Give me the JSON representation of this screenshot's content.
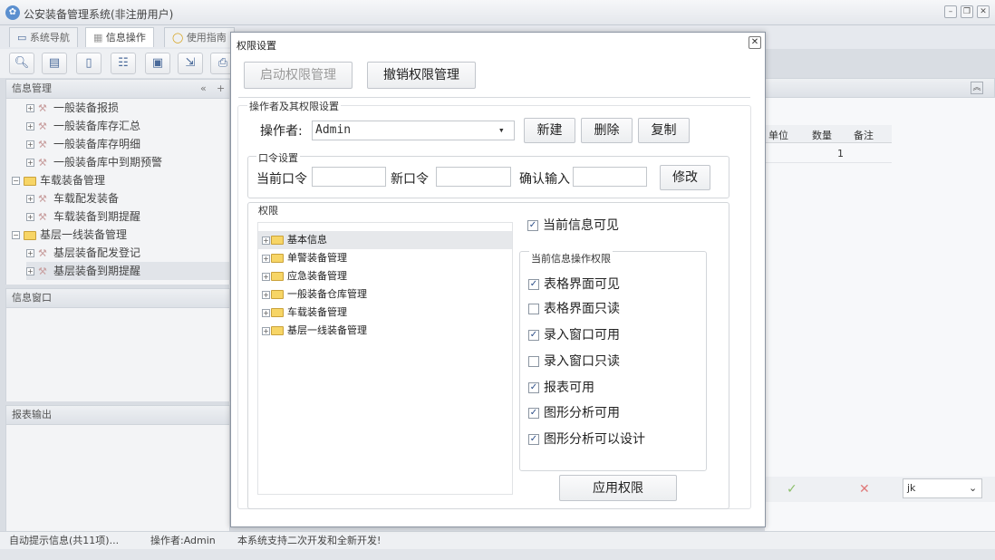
{
  "window": {
    "title": "公安装备管理系统(非注册用户)",
    "tabs": [
      "系统导航",
      "信息操作",
      "使用指南"
    ]
  },
  "left_panel": {
    "info_mgmt_title": "信息管理",
    "tree": [
      {
        "label": "一般装备报损",
        "kind": "leaf"
      },
      {
        "label": "一般装备库存汇总",
        "kind": "leaf"
      },
      {
        "label": "一般装备库存明细",
        "kind": "leaf"
      },
      {
        "label": "一般装备库中到期预警",
        "kind": "leaf"
      },
      {
        "label": "车载装备管理",
        "kind": "folder"
      },
      {
        "label": "车载配发装备",
        "kind": "leaf"
      },
      {
        "label": "车载装备到期提醒",
        "kind": "leaf"
      },
      {
        "label": "基层一线装备管理",
        "kind": "folder"
      },
      {
        "label": "基层装备配发登记",
        "kind": "leaf"
      },
      {
        "label": "基层装备到期提醒",
        "kind": "leaf"
      }
    ],
    "info_window_title": "信息窗口",
    "report_output_title": "报表输出"
  },
  "right_grid": {
    "columns": [
      "单位",
      "数量",
      "备注"
    ],
    "rows": [
      [
        "",
        "1",
        ""
      ]
    ],
    "ok_symbol": "✓",
    "cancel_symbol": "✕",
    "selector_value": "jk"
  },
  "statusbar": {
    "hint": "自动提示信息(共11项)...",
    "operator": "操作者:Admin",
    "message": "本系统支持二次开发和全新开发!"
  },
  "dialog": {
    "title": "权限设置",
    "close_symbol": "✕",
    "enable_button": "启动权限管理",
    "revoke_button": "撤销权限管理",
    "operator_section": "操作者及其权限设置",
    "operator_label": "操作者:",
    "operator_value": "Admin",
    "new_button": "新建",
    "delete_button": "删除",
    "copy_button": "复制",
    "password_section": "口令设置",
    "current_pwd_label": "当前口令",
    "new_pwd_label": "新口令",
    "confirm_pwd_label": "确认输入",
    "modify_button": "修改",
    "permission_section": "权限",
    "perm_tree": [
      "基本信息",
      "单警装备管理",
      "应急装备管理",
      "一般装备仓库管理",
      "车载装备管理",
      "基层一线装备管理"
    ],
    "current_visible_label": "当前信息可见",
    "current_visible_checked": true,
    "op_perm_section": "当前信息操作权限",
    "op_perms": [
      {
        "label": "表格界面可见",
        "checked": true
      },
      {
        "label": "表格界面只读",
        "checked": false
      },
      {
        "label": "录入窗口可用",
        "checked": true
      },
      {
        "label": "录入窗口只读",
        "checked": false
      },
      {
        "label": "报表可用",
        "checked": true
      },
      {
        "label": "图形分析可用",
        "checked": true
      },
      {
        "label": "图形分析可以设计",
        "checked": true
      }
    ],
    "apply_button": "应用权限"
  }
}
